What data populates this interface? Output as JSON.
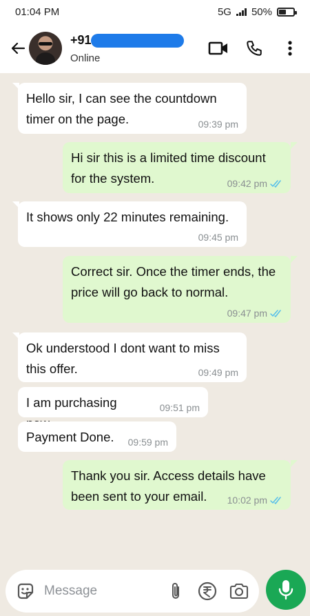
{
  "status_bar": {
    "time": "01:04 PM",
    "network": "5G",
    "battery": "50%"
  },
  "header": {
    "name": "+91",
    "status": "Online"
  },
  "messages": [
    {
      "direction": "in",
      "text": "Hello sir, I can see the countdown timer on the page.",
      "time": "09:39 pm"
    },
    {
      "direction": "out",
      "text": "Hi sir this is a limited time discount for the system.",
      "time": "09:42 pm",
      "read": true
    },
    {
      "direction": "in",
      "text": "It shows only 22 minutes remaining.",
      "time": "09:45 pm"
    },
    {
      "direction": "out",
      "text": "Correct sir. Once the timer ends, the price will go back to normal.",
      "time": "09:47 pm",
      "read": true
    },
    {
      "direction": "in",
      "text": "Ok understood I dont want to miss this offer.",
      "time": "09:49 pm"
    },
    {
      "direction": "in",
      "text": "I am purchasing now.",
      "time": "09:51 pm"
    },
    {
      "direction": "in",
      "text": "Payment Done.",
      "time": "09:59 pm"
    },
    {
      "direction": "out",
      "text": "Thank you sir. Access details have been sent to your email.",
      "time": "10:02 pm",
      "read": true
    }
  ],
  "composer": {
    "placeholder": "Message"
  },
  "colors": {
    "read_tick": "#53bdeb",
    "mic_button": "#1aa855",
    "outgoing_bubble": "#e0f8cf"
  }
}
